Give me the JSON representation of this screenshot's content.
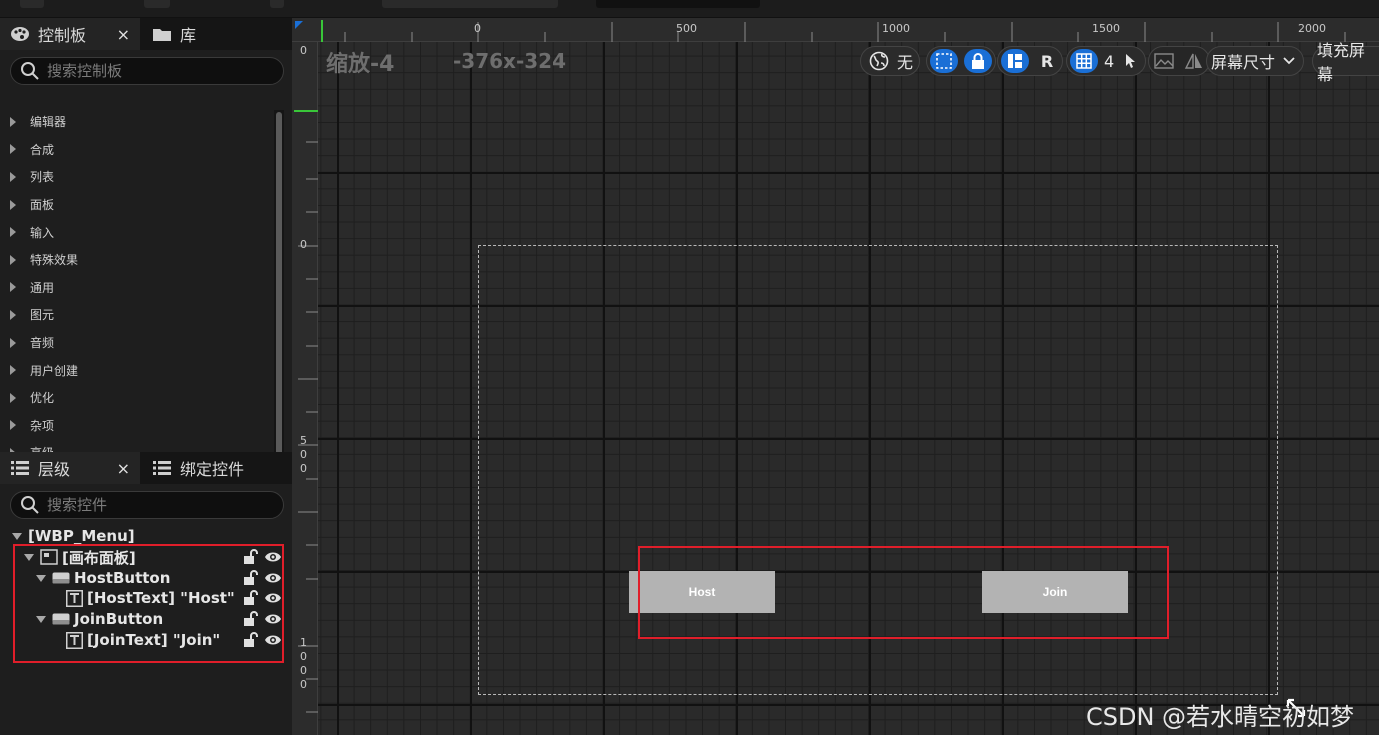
{
  "palette_panel": {
    "tab_palette": "控制板",
    "tab_library": "库",
    "close": "×",
    "search_placeholder": "搜索控制板",
    "categories": [
      "编辑器",
      "合成",
      "列表",
      "面板",
      "输入",
      "特殊效果",
      "通用",
      "图元",
      "音频",
      "用户创建",
      "优化",
      "杂项",
      "高级"
    ]
  },
  "hierarchy_panel": {
    "tab_hierarchy": "层级",
    "tab_bind": "绑定控件",
    "close": "×",
    "search_placeholder": "搜索控件",
    "root": "[WBP_Menu]",
    "items": [
      {
        "label": "[画布面板]"
      },
      {
        "label": "HostButton"
      },
      {
        "label": "[HostText] \"Host\""
      },
      {
        "label": "JoinButton"
      },
      {
        "label": "[JoinText] \"Join\""
      }
    ]
  },
  "viewport": {
    "zoom": "缩放-4",
    "size": "-376x-324",
    "ruler_top": [
      "0",
      "500",
      "1000",
      "1500",
      "2000"
    ],
    "ruler_left": [
      "0",
      "0",
      "5\n0\n0",
      "1\n0\n0\n0"
    ],
    "toolbar": {
      "world_label": "无",
      "r_label": "R",
      "grid_value": "4",
      "screen_size": "屏幕尺寸",
      "fill_screen": "填充屏幕"
    },
    "buttons": {
      "host": "Host",
      "join": "Join"
    }
  },
  "watermark": "CSDN @若水晴空初如梦",
  "colors": {
    "highlight_red": "#e01e2a",
    "accent_blue": "#1a6fd6",
    "button_gray": "#b3b3b3"
  }
}
